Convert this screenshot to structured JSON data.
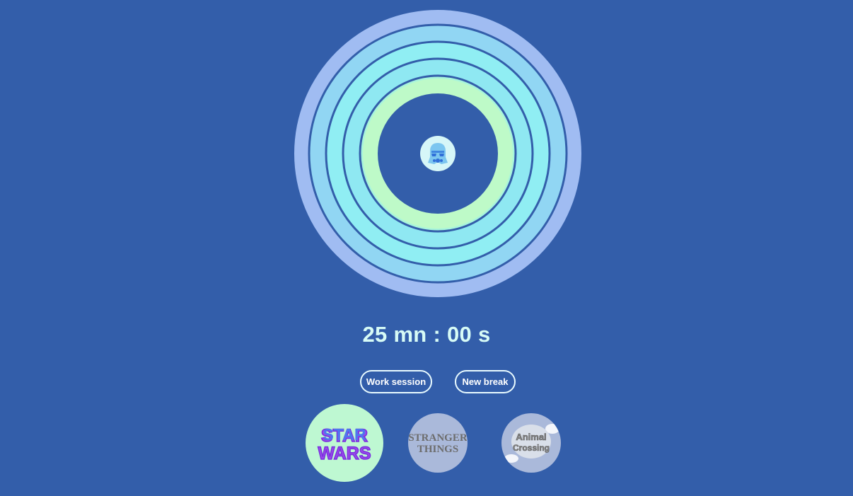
{
  "timer": {
    "display": "25 mn : 00 s"
  },
  "controls": {
    "work_label": "Work session",
    "break_label": "New break"
  },
  "themes": [
    {
      "name": "STAR WARS",
      "line1": "STAR",
      "line2": "WARS",
      "selected": true
    },
    {
      "name": "STRANGER THINGS",
      "line1": "STRANGER",
      "line2": "THINGS",
      "selected": false
    },
    {
      "name": "Animal Crossing",
      "line1": "Animal",
      "line2": "Crossing",
      "selected": false
    }
  ],
  "center_icon": "stormtrooper-helmet-icon",
  "colors": {
    "background": "#335eaa",
    "ring_outer": "#a0bcf2",
    "ring_cyan": "#8fe8f2",
    "ring_inner": "#befac8",
    "text": "#d7fbf6"
  }
}
